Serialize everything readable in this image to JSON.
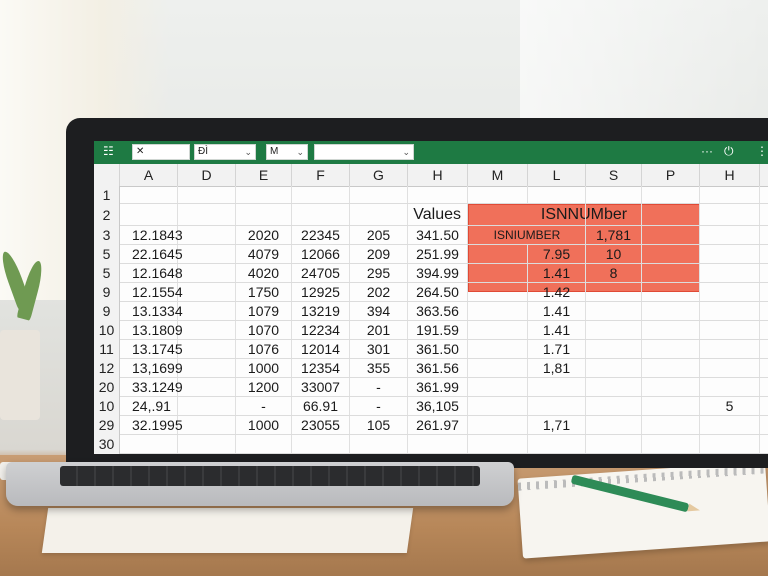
{
  "ribbon": {
    "menu_icon": "☷",
    "font_box": "✕",
    "style_box": "ÐÌ",
    "size_box": "M",
    "formula_box": "",
    "chevron": "⌄",
    "right_icons": [
      "···",
      "⏻",
      "⋮"
    ]
  },
  "columns": [
    "A",
    "D",
    "E",
    "F",
    "G",
    "H",
    "M",
    "L",
    "S",
    "P",
    "H"
  ],
  "rows": [
    {
      "num": "1",
      "cells": [
        "",
        "",
        "",
        "",
        "",
        "",
        "",
        "",
        "",
        "",
        ""
      ]
    },
    {
      "num": "2",
      "cells": [
        "",
        "",
        "",
        "",
        "",
        "Values",
        "ISNNUMber",
        "",
        "",
        "",
        ""
      ]
    },
    {
      "num": "3",
      "cells": [
        "12.1843",
        "",
        "2020",
        "22345",
        "205",
        "341.50",
        "ISNIUMBER",
        "",
        "1,781",
        "",
        ""
      ]
    },
    {
      "num": "5",
      "cells": [
        "22.1645",
        "",
        "4079",
        "12066",
        "209",
        "251.99",
        "",
        "7.95",
        "10",
        "",
        ""
      ]
    },
    {
      "num": "5",
      "cells": [
        "12.1648",
        "",
        "4020",
        "24705",
        "295",
        "394.99",
        "",
        "1.41",
        "8",
        "",
        ""
      ]
    },
    {
      "num": "9",
      "cells": [
        "12.1554",
        "",
        "1750",
        "12925",
        "202",
        "264.50",
        "",
        "1.42",
        "",
        "",
        ""
      ]
    },
    {
      "num": "9",
      "cells": [
        "13.1334",
        "",
        "1079",
        "13219",
        "394",
        "363.56",
        "",
        "1.41",
        "",
        "",
        ""
      ]
    },
    {
      "num": "10",
      "cells": [
        "13.1809",
        "",
        "1070",
        "12234",
        "201",
        "191.59",
        "",
        "1.41",
        "",
        "",
        ""
      ]
    },
    {
      "num": "11",
      "cells": [
        "13.1745",
        "",
        "1076",
        "12014",
        "301",
        "361.50",
        "",
        "1.71",
        "",
        "",
        ""
      ]
    },
    {
      "num": "12",
      "cells": [
        "13,1699",
        "",
        "1000",
        "12354",
        "355",
        "361.56",
        "",
        "1,81",
        "",
        "",
        ""
      ]
    },
    {
      "num": "20",
      "cells": [
        "33.1249",
        "",
        "1200",
        "33007",
        "-",
        "361.99",
        "",
        "",
        "",
        "",
        ""
      ]
    },
    {
      "num": "10",
      "cells": [
        "24,.91",
        "",
        "-",
        "66.91",
        "-",
        "36,105",
        "",
        "",
        "",
        "",
        "5"
      ]
    },
    {
      "num": "29",
      "cells": [
        "32.1995",
        "",
        "1000",
        "23055",
        "105",
        "261.97",
        "",
        "1,71",
        "",
        "",
        ""
      ]
    },
    {
      "num": "30",
      "cells": [
        "",
        "",
        "",
        "",
        "",
        "",
        "",
        "",
        "",
        "",
        ""
      ]
    }
  ],
  "highlight_color": "#f0705a",
  "accent_color": "#1e7a43"
}
